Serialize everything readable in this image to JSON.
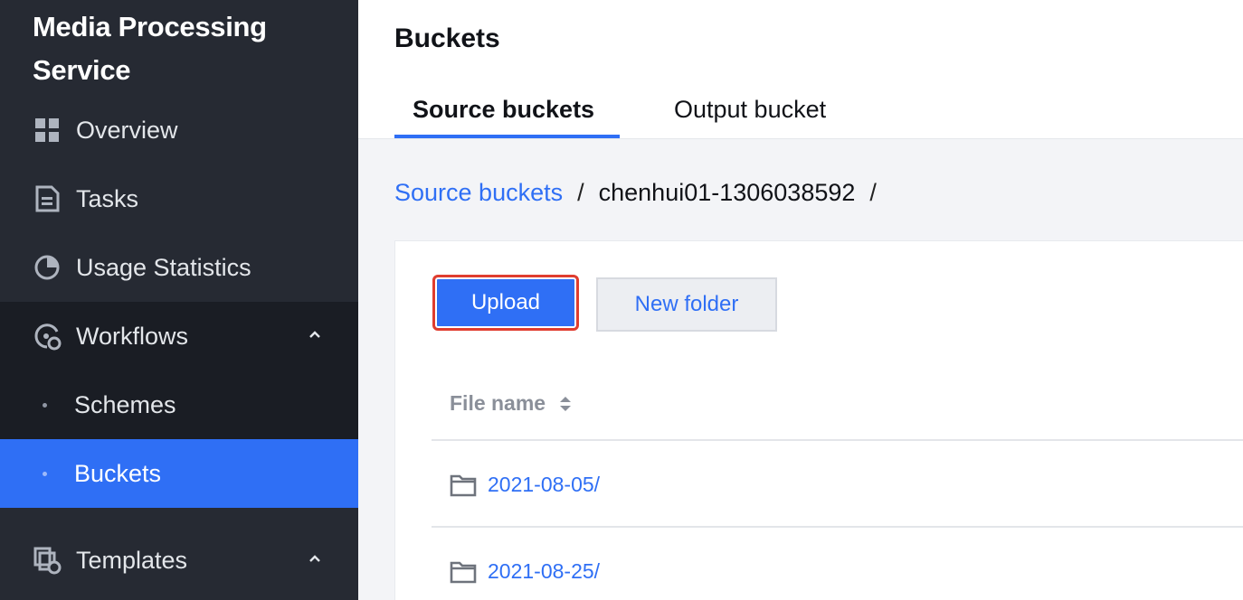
{
  "sidebar": {
    "brand": "Media Processing Service",
    "items": [
      {
        "label": "Overview",
        "icon": "grid-icon"
      },
      {
        "label": "Tasks",
        "icon": "document-icon"
      },
      {
        "label": "Usage Statistics",
        "icon": "pie-chart-icon"
      },
      {
        "label": "Workflows",
        "icon": "workflow-icon",
        "expanded": true
      },
      {
        "label": "Templates",
        "icon": "template-icon",
        "expanded": true
      }
    ],
    "workflow_children": [
      {
        "label": "Schemes"
      },
      {
        "label": "Buckets",
        "active": true
      }
    ]
  },
  "header": {
    "title": "Buckets",
    "tabs": [
      {
        "label": "Source buckets",
        "active": true
      },
      {
        "label": "Output bucket"
      }
    ]
  },
  "breadcrumb": {
    "root": "Source buckets",
    "current": "chenhui01-1306038592",
    "separator": "/"
  },
  "toolbar": {
    "upload_label": "Upload",
    "new_folder_label": "New folder"
  },
  "table": {
    "columns": [
      {
        "label": "File name",
        "sortable": true
      }
    ],
    "rows": [
      {
        "name": "2021-08-05/",
        "type": "folder"
      },
      {
        "name": "2021-08-25/",
        "type": "folder"
      }
    ]
  },
  "colors": {
    "accent": "#2f6ff5",
    "sidebar_bg": "#262a33",
    "highlight_border": "#e03d2f"
  }
}
